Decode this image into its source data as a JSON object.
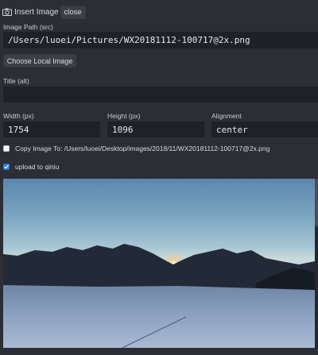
{
  "header": {
    "title": "Insert Image",
    "close_label": "close"
  },
  "image_path": {
    "label": "Image Path (src)",
    "value": "/Users/luoei/Pictures/WX20181112-100717@2x.png"
  },
  "choose_button_label": "Choose Local Image",
  "title_field": {
    "label": "Title (alt)",
    "value": ""
  },
  "width_field": {
    "label": "Width (px)",
    "value": "1754"
  },
  "height_field": {
    "label": "Height (px)",
    "value": "1096"
  },
  "alignment_field": {
    "label": "Alignment",
    "value": "center"
  },
  "copy_image": {
    "label": "Copy Image To: /Users/luoei/Desktop/images/2018/11/WX20181112-100717@2x.png",
    "checked": false
  },
  "upload": {
    "label": "upload to qiniu",
    "checked": true
  },
  "colors": {
    "background": "#2b2e35",
    "input_background": "#1f2126",
    "button_background": "#3c3f46",
    "checkbox_checked": "#2e78e0"
  },
  "icons": {
    "header": "camera-icon",
    "upload_checkbox": "checkmark-icon"
  }
}
